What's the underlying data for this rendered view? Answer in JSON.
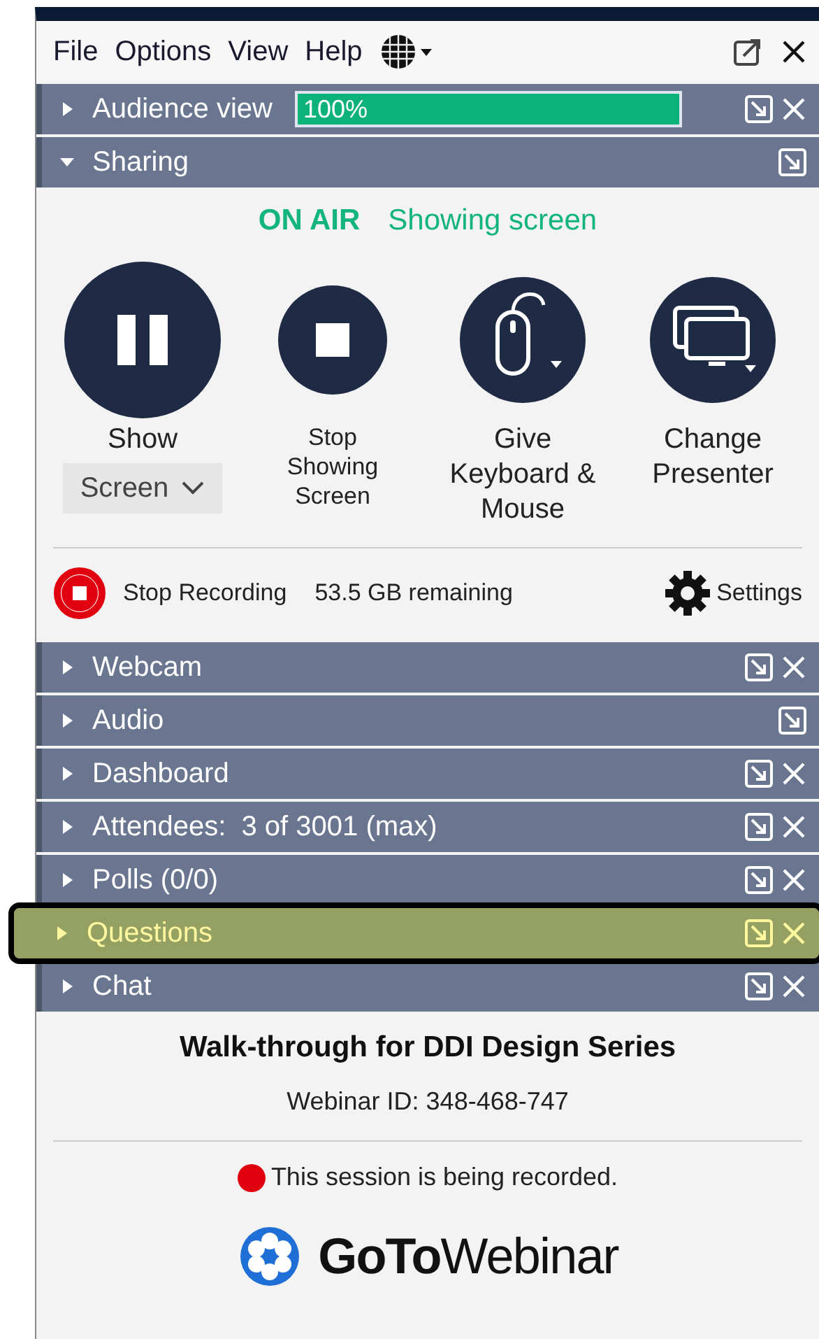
{
  "menu": [
    "File",
    "Options",
    "View",
    "Help"
  ],
  "panels_top": [
    {
      "title": "Audience view",
      "expanded": false,
      "closable": true,
      "highlighted": false,
      "meter": {
        "level": 1.0,
        "reading": "100%"
      }
    },
    {
      "title": "Sharing",
      "expanded": true,
      "closable": false,
      "highlighted": false
    }
  ],
  "sharing": {
    "status": "ON AIR",
    "activity": "Showing screen",
    "actions": [
      {
        "kind": "pause",
        "label": "Show",
        "dropdown": "Screen"
      },
      {
        "kind": "stop",
        "label": "Stop Showing Screen"
      },
      {
        "kind": "mouse",
        "label": "Give Keyboard & Mouse"
      },
      {
        "kind": "presenter",
        "label": "Change Presenter"
      }
    ],
    "recording": {
      "label": "Stop Recording",
      "remaining": "53.5 GB remaining",
      "settings": "Settings"
    }
  },
  "panels": [
    {
      "title": "Webcam",
      "expanded": false,
      "closable": true,
      "highlighted": false
    },
    {
      "title": "Audio",
      "expanded": false,
      "closable": false,
      "highlighted": false
    },
    {
      "title": "Dashboard",
      "expanded": false,
      "closable": true,
      "highlighted": false
    },
    {
      "title": "Attendees:  3 of 3001 (max)",
      "expanded": false,
      "closable": true,
      "highlighted": false
    },
    {
      "title": "Polls (0/0)",
      "expanded": false,
      "closable": true,
      "highlighted": false
    },
    {
      "title": "Questions",
      "expanded": false,
      "closable": true,
      "highlighted": true
    },
    {
      "title": "Chat",
      "expanded": false,
      "closable": true,
      "highlighted": false
    }
  ],
  "footer": {
    "webinar_title": "Walk-through for DDI Design Series",
    "webinar_id": "Webinar ID: 348-468-747",
    "recording_notice": "This session is being recorded.",
    "logo": "**GoTo**Webinar"
  }
}
